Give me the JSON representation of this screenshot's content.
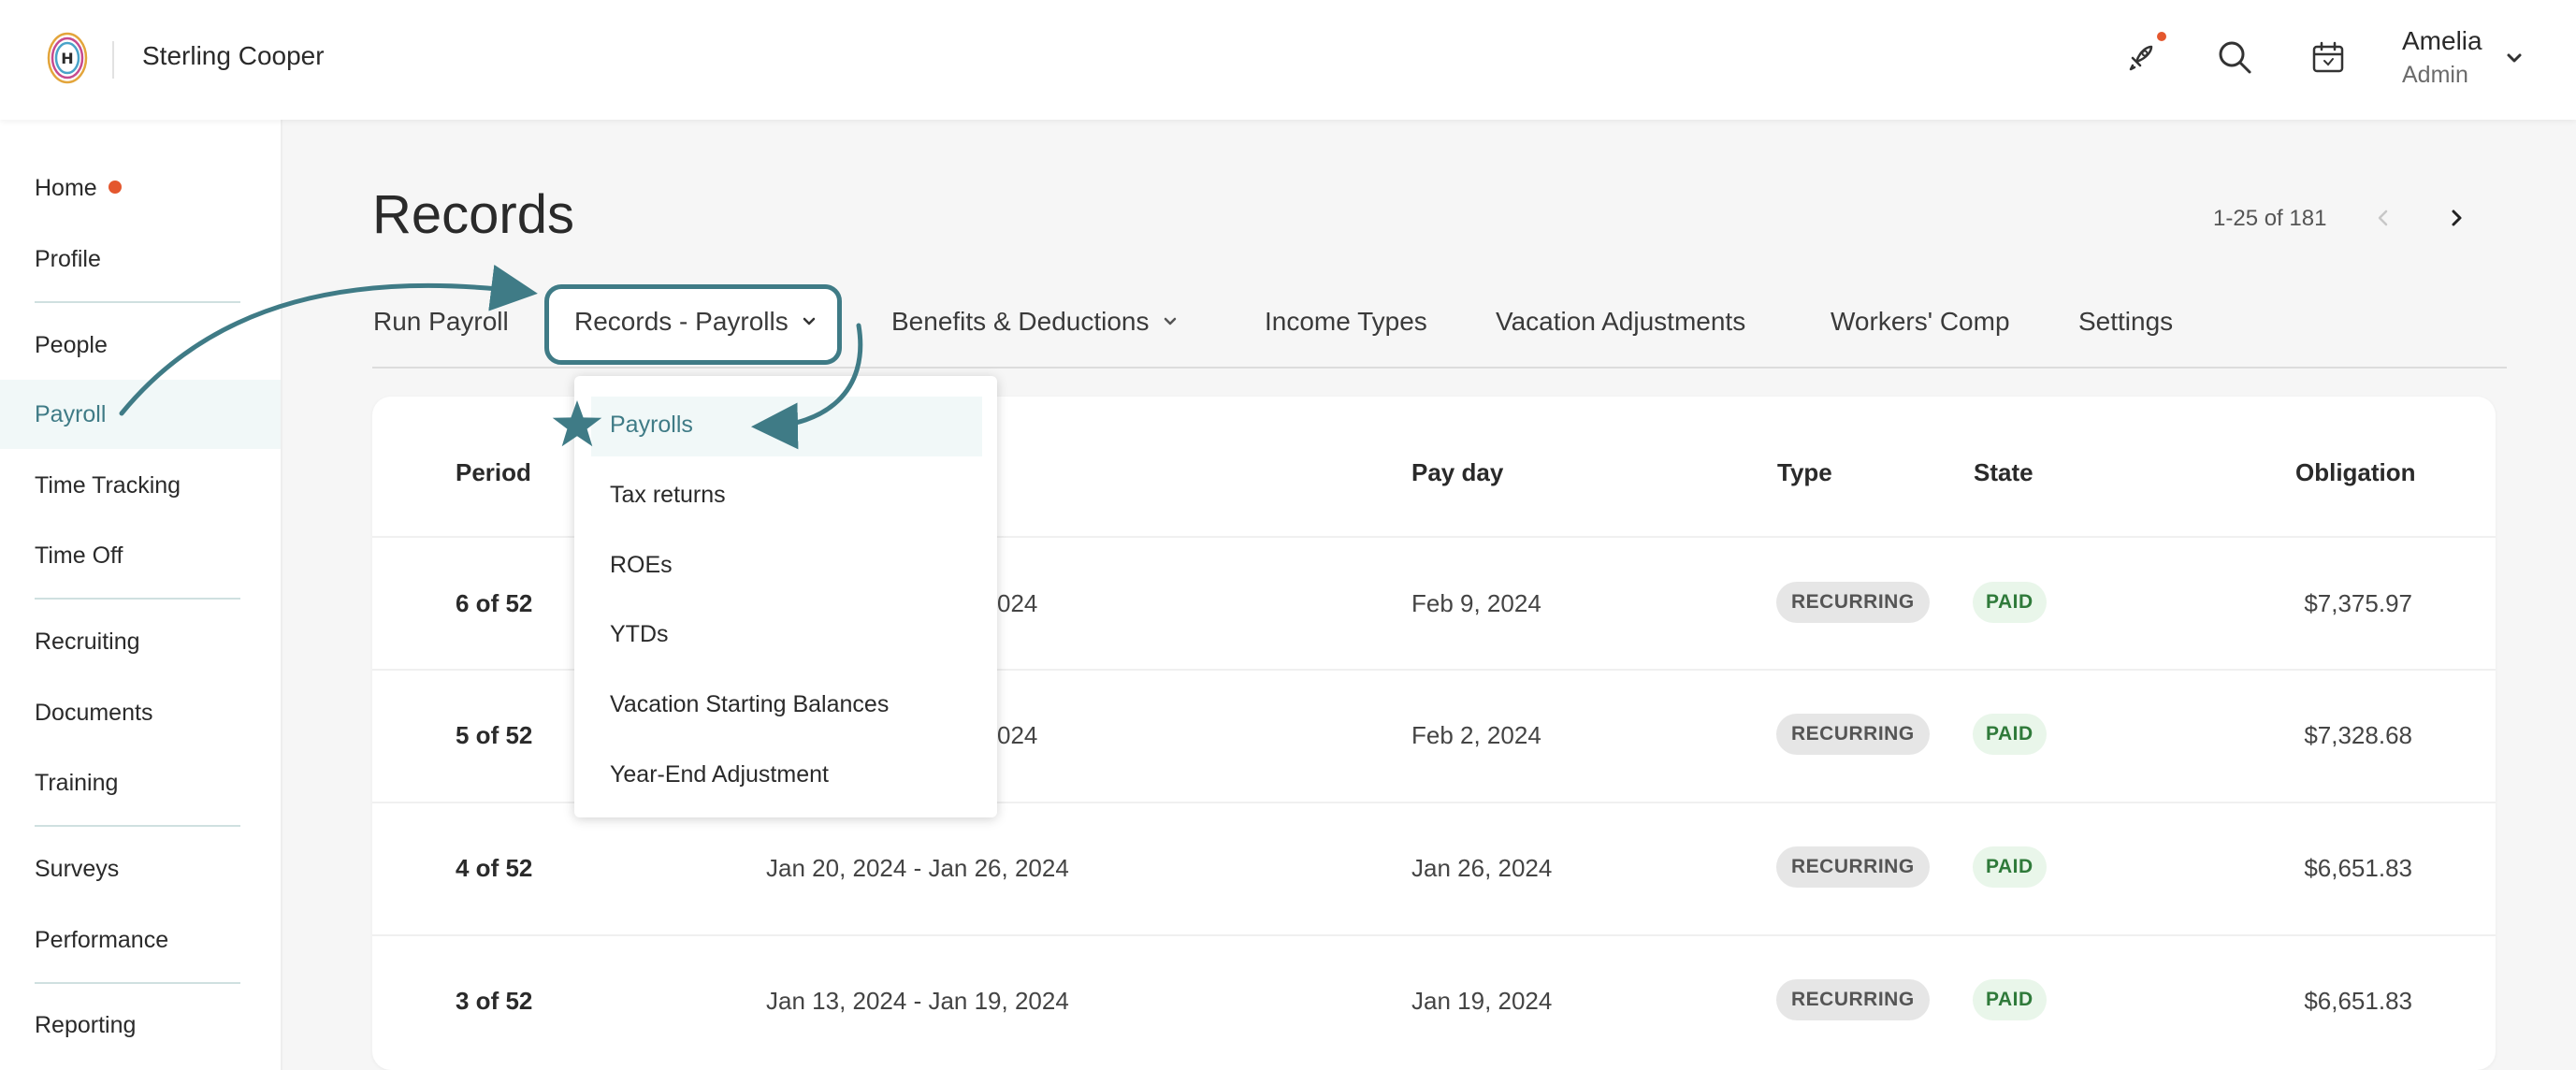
{
  "header": {
    "company": "Sterling Cooper",
    "user_name": "Amelia",
    "user_role": "Admin",
    "icons": [
      "hibob-logo",
      "rocket-icon",
      "search-icon",
      "calendar-icon",
      "chevron-down-icon"
    ]
  },
  "sidebar": {
    "items": [
      {
        "label": "Home",
        "notify": true
      },
      {
        "label": "Profile"
      },
      {
        "label": "People"
      },
      {
        "label": "Payroll",
        "active": true
      },
      {
        "label": "Time Tracking"
      },
      {
        "label": "Time Off"
      },
      {
        "label": "Recruiting"
      },
      {
        "label": "Documents"
      },
      {
        "label": "Training"
      },
      {
        "label": "Surveys"
      },
      {
        "label": "Performance"
      },
      {
        "label": "Reporting"
      }
    ]
  },
  "page": {
    "title": "Records",
    "pager": "1-25 of 181"
  },
  "tabs": [
    {
      "label": "Run Payroll"
    },
    {
      "label": "Records - Payrolls",
      "active": true
    },
    {
      "label": "Benefits & Deductions"
    },
    {
      "label": "Income Types"
    },
    {
      "label": "Vacation Adjustments"
    },
    {
      "label": "Workers' Comp"
    },
    {
      "label": "Settings"
    }
  ],
  "dropdown": {
    "items": [
      "Payrolls",
      "Tax returns",
      "ROEs",
      "YTDs",
      "Vacation Starting Balances",
      "Year-End Adjustment"
    ],
    "selected": "Payrolls"
  },
  "table": {
    "columns": [
      "Period",
      "Pay day",
      "Type",
      "State",
      "Obligation"
    ],
    "rows": [
      {
        "period": "6 of 52",
        "dates": "024",
        "payday": "Feb 9, 2024",
        "type": "RECURRING",
        "state": "PAID",
        "obligation": "$7,375.97"
      },
      {
        "period": "5 of 52",
        "dates": "024",
        "payday": "Feb 2, 2024",
        "type": "RECURRING",
        "state": "PAID",
        "obligation": "$7,328.68"
      },
      {
        "period": "4 of 52",
        "dates": "Jan 20, 2024 - Jan 26, 2024",
        "payday": "Jan 26, 2024",
        "type": "RECURRING",
        "state": "PAID",
        "obligation": "$6,651.83"
      },
      {
        "period": "3 of 52",
        "dates": "Jan 13, 2024 - Jan 19, 2024",
        "payday": "Jan 19, 2024",
        "type": "RECURRING",
        "state": "PAID",
        "obligation": "$6,651.83"
      }
    ]
  },
  "colors": {
    "accent": "#3f7b86",
    "notify": "#e4572e",
    "paid_bg": "#e9f6ea",
    "paid_text": "#2f7a3a"
  }
}
